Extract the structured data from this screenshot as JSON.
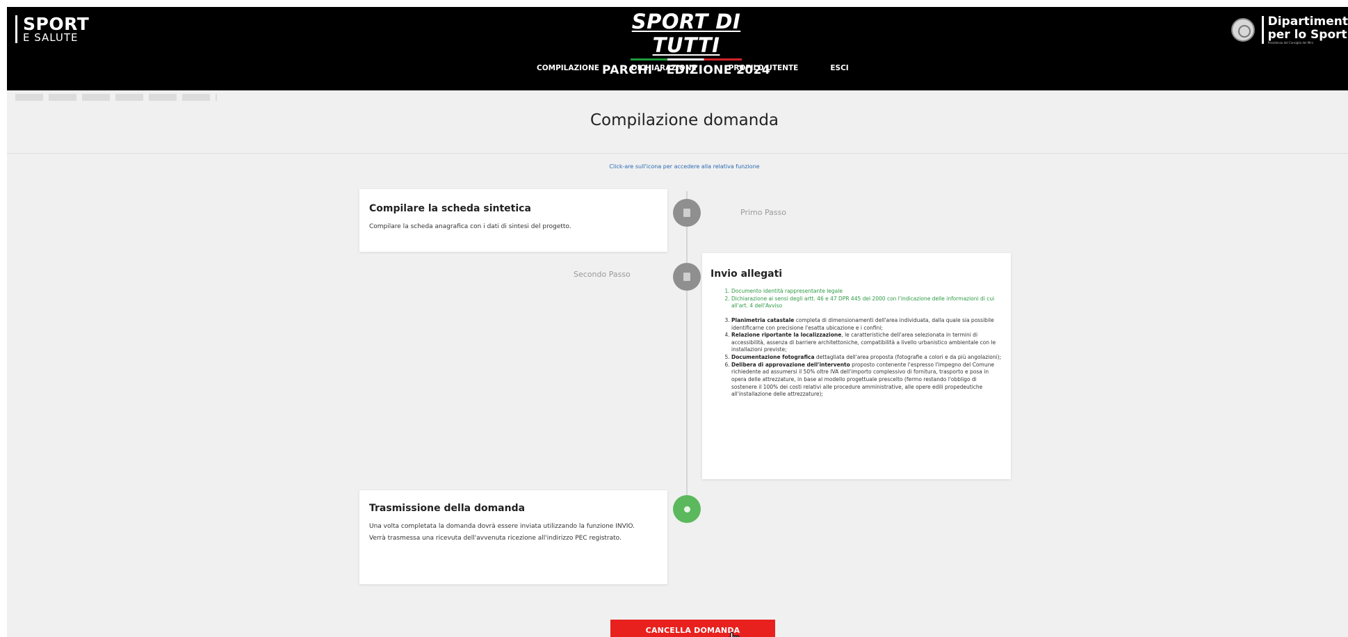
{
  "header": {
    "logo_left": {
      "line1": "SPORT",
      "line2": "E SALUTE"
    },
    "brand_title": "SPORT DI TUTTI",
    "brand_edition": "PARCHI - EDIZIONE 2024",
    "nav": [
      "COMPILAZIONE",
      "DICHIARAZIONE",
      "PROFILO UTENTE",
      "ESCI"
    ],
    "logo_right": {
      "line1": "Dipartiment",
      "line2": "per lo Sport",
      "small": "Presidenza del Consiglio dei Mini"
    }
  },
  "main": {
    "title": "Compilazione domanda",
    "hint": "Click-are sull'icona per accedere alla relativa funzione"
  },
  "steps": {
    "step1": {
      "label": "Primo Passo",
      "card_title": "Compilare la scheda sintetica",
      "card_text": "Compilare la scheda anagrafica con i dati di sintesi del progetto."
    },
    "step2": {
      "label": "Secondo Passo",
      "card_title": "Invio allegati",
      "items": [
        "Documento identità rappresentante legale",
        "Dichiarazione ai sensi degli artt. 46 e 47 DPR 445 del 2000 con l'indicazione delle informazioni di cui all'art. 4 dell'Avviso",
        {
          "bold": "Planimetria catastale",
          "text": " completa di dimensionamenti dell'area individuata, dalla quale sia possibile identificarne con precisione l'esatta ubicazione e i confini;"
        },
        {
          "bold": "Relazione riportante la localizzazione",
          "text": ", le caratteristiche dell'area selezionata in termini di accessibilità, assenza di barriere architettoniche, compatibilità a livello urbanistico ambientale con le installazioni previste;"
        },
        {
          "bold": "Documentazione fotografica",
          "text": " dettagliata dell'area proposta (fotografie a colori e da più angolazioni);"
        },
        {
          "bold": "Delibera di approvazione dell'intervento",
          "text": " proposto contenente l'espresso l'impegno del Comune richiedente ad assumersi il 50% oltre IVA dell'importo complessivo di fornitura, trasporto e posa in opera delle attrezzature, in base al modello progettuale prescelto (fermo restando l'obbligo di sostenere il 100% dei costi relativi alle procedure amministrative, alle opere edili propedeutiche all'installazione delle attrezzature);"
        }
      ]
    },
    "step3": {
      "card_title": "Trasmissione della domanda",
      "card_text1": "Una volta completata la domanda dovrà essere inviata utilizzando la funzione INVIO.",
      "card_text2": "Verrà trasmessa una ricevuta dell'avvenuta ricezione all'indirizzo PEC registrato."
    }
  },
  "actions": {
    "cancel_label": "CANCELLA DOMANDA"
  },
  "colors": {
    "accent_red": "#e8211e",
    "green": "#5cb85c",
    "link_blue": "#2a6ab4"
  }
}
